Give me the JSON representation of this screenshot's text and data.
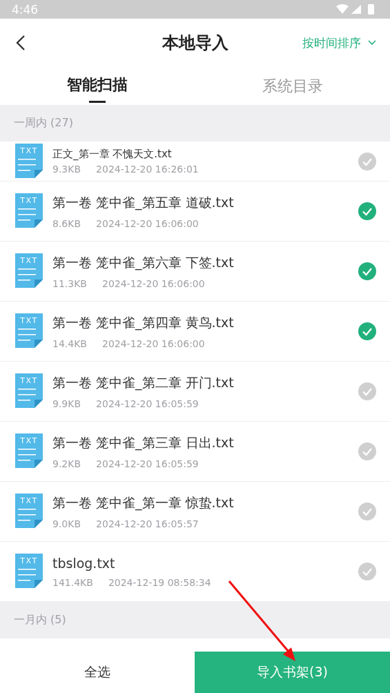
{
  "status_bar": {
    "time": "4:46"
  },
  "header": {
    "title": "本地导入",
    "sort": "按时间排序"
  },
  "tabs": [
    {
      "label": "智能扫描",
      "selected": true
    },
    {
      "label": "系统目录",
      "selected": false
    }
  ],
  "sections": [
    {
      "title": "一周内 (27)",
      "files": [
        {
          "icon_label": "TXT",
          "name": "正文_第一章 不愧天文.txt",
          "size": "9.3KB",
          "time": "2024-12-20 16:26:01",
          "selected": false
        },
        {
          "icon_label": "TXT",
          "name": "第一卷 笼中雀_第五章 道破.txt",
          "size": "8.6KB",
          "time": "2024-12-20 16:06:00",
          "selected": true
        },
        {
          "icon_label": "TXT",
          "name": "第一卷 笼中雀_第六章 下签.txt",
          "size": "11.3KB",
          "time": "2024-12-20 16:06:00",
          "selected": true
        },
        {
          "icon_label": "TXT",
          "name": "第一卷 笼中雀_第四章 黄鸟.txt",
          "size": "14.4KB",
          "time": "2024-12-20 16:06:00",
          "selected": true
        },
        {
          "icon_label": "TXT",
          "name": "第一卷 笼中雀_第二章 开门.txt",
          "size": "9.9KB",
          "time": "2024-12-20 16:05:59",
          "selected": false
        },
        {
          "icon_label": "TXT",
          "name": "第一卷 笼中雀_第三章 日出.txt",
          "size": "9.2KB",
          "time": "2024-12-20 16:05:59",
          "selected": false
        },
        {
          "icon_label": "TXT",
          "name": "第一卷 笼中雀_第一章 惊蛰.txt",
          "size": "9.0KB",
          "time": "2024-12-20 16:05:57",
          "selected": false
        },
        {
          "icon_label": "TXT",
          "name": "tbslog.txt",
          "size": "141.4KB",
          "time": "2024-12-19 08:58:34",
          "selected": false
        }
      ]
    },
    {
      "title": "一月内 (5)"
    }
  ],
  "footer": {
    "select_all": "全选",
    "import": "导入书架(3)"
  }
}
